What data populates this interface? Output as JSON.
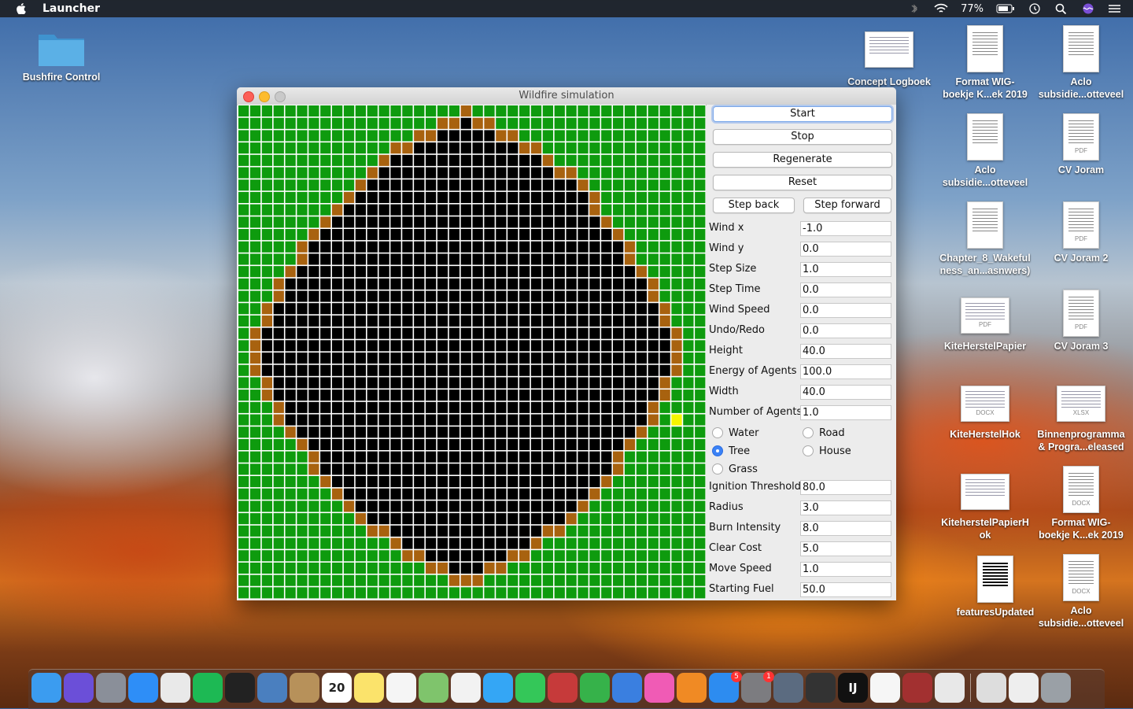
{
  "menubar": {
    "app_name": "Launcher",
    "battery": "77%",
    "icons": [
      "apple-icon",
      "bluetooth-icon",
      "wifi-icon",
      "battery-icon",
      "time-machine-icon",
      "spotlight-icon",
      "siri-icon",
      "notification-center-icon"
    ]
  },
  "desktop": {
    "items": [
      {
        "label_1": "Bushfire Control",
        "label_2": "",
        "kind": "folder"
      },
      {
        "label_1": "Concept Logboek",
        "label_2": "",
        "kind": "spreadsheet"
      },
      {
        "label_1": "Format WIG-",
        "label_2": "boekje K...ek 2019",
        "kind": "document"
      },
      {
        "label_1": "Aclo",
        "label_2": "subsidie...otteveel",
        "kind": "document"
      },
      {
        "label_1": "Aclo",
        "label_2": "subsidie...otteveel",
        "kind": "document"
      },
      {
        "label_1": "CV Joram",
        "label_2": "",
        "kind": "pdf",
        "tag": "PDF"
      },
      {
        "label_1": "Chapter_8_Wakeful",
        "label_2": "ness_an...asnwers)",
        "kind": "document"
      },
      {
        "label_1": "CV Joram 2",
        "label_2": "",
        "kind": "pdf",
        "tag": "PDF"
      },
      {
        "label_1": "KiteHerstelPapier",
        "label_2": "",
        "kind": "pdf",
        "tag": "PDF"
      },
      {
        "label_1": "CV Joram 3",
        "label_2": "",
        "kind": "pdf",
        "tag": "PDF"
      },
      {
        "label_1": "KiteHerstelHok",
        "label_2": "",
        "kind": "docx",
        "tag": "DOCX"
      },
      {
        "label_1": "Binnenprogramma",
        "label_2": "& Progra...eleased",
        "kind": "xlsx",
        "tag": "XLSX"
      },
      {
        "label_1": "KiteherstelPapierH",
        "label_2": "ok",
        "kind": "pdf",
        "tag": ""
      },
      {
        "label_1": "Format WIG-",
        "label_2": "boekje K...ek 2019",
        "kind": "docx",
        "tag": "DOCX"
      },
      {
        "label_1": "featuresUpdated",
        "label_2": "",
        "kind": "document"
      },
      {
        "label_1": "Aclo",
        "label_2": "subsidie...otteveel",
        "kind": "docx",
        "tag": "DOCX"
      }
    ]
  },
  "window": {
    "title": "Wildfire simulation"
  },
  "grid": {
    "rows": 40,
    "cols": 40,
    "colors": {
      "grass": "#0e9b0e",
      "burning": "#a8620f",
      "burnt": "#000000",
      "agent": "#f5f500",
      "lines": "#ffffff"
    },
    "burnt_row_ranges": [
      null,
      [
        19,
        19
      ],
      [
        17,
        21
      ],
      [
        15,
        23
      ],
      [
        13,
        25
      ],
      [
        12,
        26
      ],
      [
        11,
        28
      ],
      [
        10,
        29
      ],
      [
        9,
        29
      ],
      [
        8,
        30
      ],
      [
        7,
        31
      ],
      [
        6,
        32
      ],
      [
        6,
        32
      ],
      [
        5,
        33
      ],
      [
        4,
        34
      ],
      [
        4,
        34
      ],
      [
        3,
        35
      ],
      [
        3,
        35
      ],
      [
        2,
        36
      ],
      [
        2,
        36
      ],
      [
        2,
        36
      ],
      [
        2,
        36
      ],
      [
        3,
        35
      ],
      [
        3,
        35
      ],
      [
        4,
        34
      ],
      [
        4,
        34
      ],
      [
        5,
        33
      ],
      [
        6,
        32
      ],
      [
        7,
        31
      ],
      [
        7,
        31
      ],
      [
        8,
        30
      ],
      [
        9,
        29
      ],
      [
        10,
        28
      ],
      [
        11,
        27
      ],
      [
        13,
        25
      ],
      [
        14,
        24
      ],
      [
        16,
        22
      ],
      [
        18,
        20
      ],
      null,
      null
    ],
    "agent_cell": {
      "row": 25,
      "col": 37
    }
  },
  "panel": {
    "buttons": {
      "start": "Start",
      "stop": "Stop",
      "regenerate": "Regenerate",
      "reset": "Reset",
      "step_back": "Step back",
      "step_forward": "Step forward"
    },
    "fields_top": [
      {
        "label": "Wind x",
        "value": "-1.0"
      },
      {
        "label": "Wind y",
        "value": "0.0"
      },
      {
        "label": "Step Size",
        "value": "1.0"
      },
      {
        "label": "Step Time",
        "value": "0.0"
      },
      {
        "label": "Wind Speed",
        "value": "0.0"
      },
      {
        "label": "Undo/Redo",
        "value": "0.0"
      },
      {
        "label": "Height",
        "value": "40.0"
      },
      {
        "label": "Energy of Agents",
        "value": "100.0"
      },
      {
        "label": "Width",
        "value": "40.0"
      },
      {
        "label": "Number of Agents",
        "value": "1.0"
      }
    ],
    "radios": {
      "water": "Water",
      "road": "Road",
      "tree": "Tree",
      "house": "House",
      "grass": "Grass",
      "selected": "Tree"
    },
    "fields_bottom": [
      {
        "label": "Ignition Threshold",
        "value": "80.0"
      },
      {
        "label": "Radius",
        "value": "3.0"
      },
      {
        "label": "Burn Intensity",
        "value": "8.0"
      },
      {
        "label": "Clear Cost",
        "value": "5.0"
      },
      {
        "label": "Move Speed",
        "value": "1.0"
      },
      {
        "label": "Starting Fuel",
        "value": "50.0"
      }
    ]
  },
  "dock": {
    "items": [
      {
        "name": "finder",
        "color": "#3b9cf0"
      },
      {
        "name": "siri",
        "color": "#6b4fd8"
      },
      {
        "name": "launchpad",
        "color": "#8a8f99"
      },
      {
        "name": "safari",
        "color": "#2e8ef7"
      },
      {
        "name": "chrome",
        "color": "#e9e9e9"
      },
      {
        "name": "spotify",
        "color": "#1db954"
      },
      {
        "name": "terminal",
        "color": "#222222"
      },
      {
        "name": "preview",
        "color": "#4a7fbf"
      },
      {
        "name": "contacts",
        "color": "#b7915a"
      },
      {
        "name": "calendar",
        "color": "#ffffff",
        "text": "20"
      },
      {
        "name": "notes",
        "color": "#fbe36b"
      },
      {
        "name": "reminders",
        "color": "#f5f5f5"
      },
      {
        "name": "maps",
        "color": "#7fc46c"
      },
      {
        "name": "photos",
        "color": "#f2f2f2"
      },
      {
        "name": "messages",
        "color": "#34a6f5"
      },
      {
        "name": "facetime",
        "color": "#34c759"
      },
      {
        "name": "photo-booth",
        "color": "#c63a3a"
      },
      {
        "name": "numbers",
        "color": "#36b24a"
      },
      {
        "name": "keynote",
        "color": "#3a7fe0"
      },
      {
        "name": "itunes",
        "color": "#f05bb5"
      },
      {
        "name": "books",
        "color": "#f08a24"
      },
      {
        "name": "app-store",
        "color": "#2d8cf0",
        "badge": "5"
      },
      {
        "name": "system-preferences",
        "color": "#7c7c80",
        "badge": "1"
      },
      {
        "name": "image-capture",
        "color": "#5b6b80"
      },
      {
        "name": "screen-sharing",
        "color": "#333333"
      },
      {
        "name": "intellij",
        "color": "#111111",
        "text": "IJ"
      },
      {
        "name": "textedit",
        "color": "#f6f6f6"
      },
      {
        "name": "photo-slideshow",
        "color": "#a23030"
      },
      {
        "name": "java",
        "color": "#e8e8e8"
      },
      {
        "name": "downloads-stack",
        "color": "#dddddd"
      },
      {
        "name": "documents-stack",
        "color": "#eeeeee"
      },
      {
        "name": "trash",
        "color": "#9aa0a6"
      }
    ]
  }
}
